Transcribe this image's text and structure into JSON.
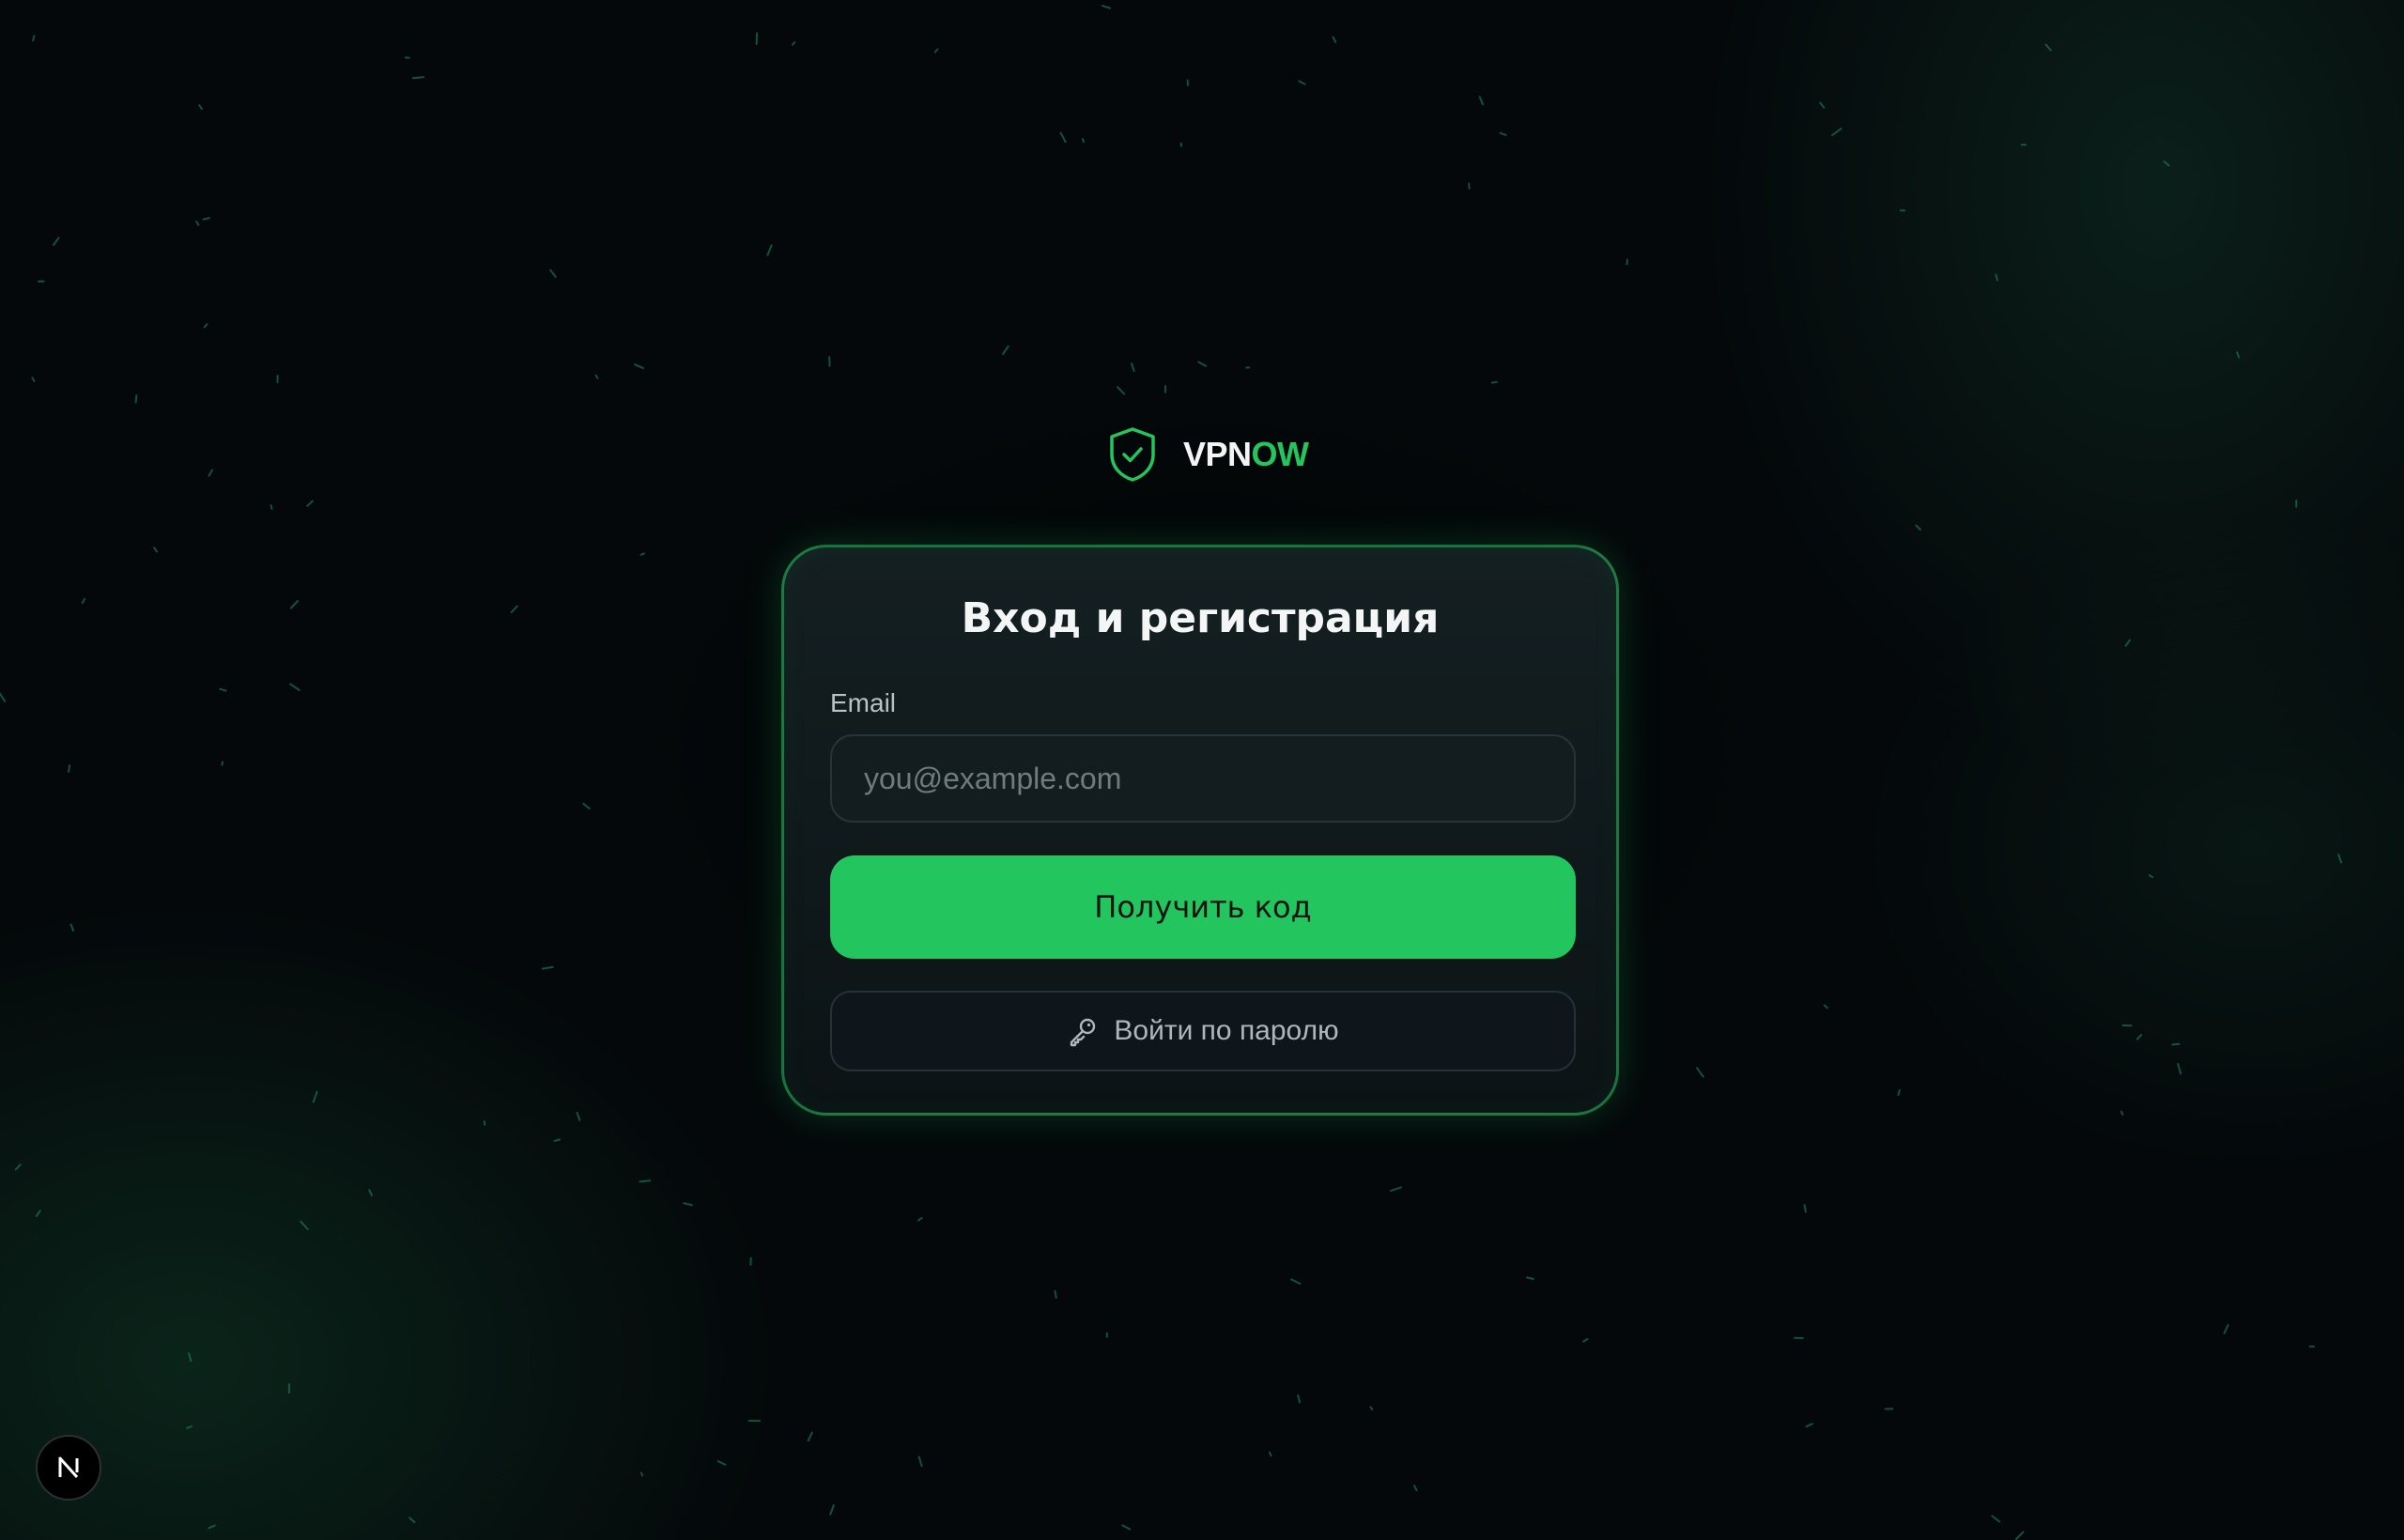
{
  "brand": {
    "name_main": "VPN",
    "name_accent": "OW",
    "icon": "shield-check-icon",
    "accent_color": "#22c55e"
  },
  "login_card": {
    "title": "Вход и регистрация",
    "email_label": "Email",
    "email_placeholder": "you@example.com",
    "email_value": "",
    "submit_label": "Получить код",
    "password_login_label": "Войти по паролю",
    "password_login_icon": "key-icon"
  },
  "dev_badge": {
    "icon": "nextjs-logo-icon"
  }
}
